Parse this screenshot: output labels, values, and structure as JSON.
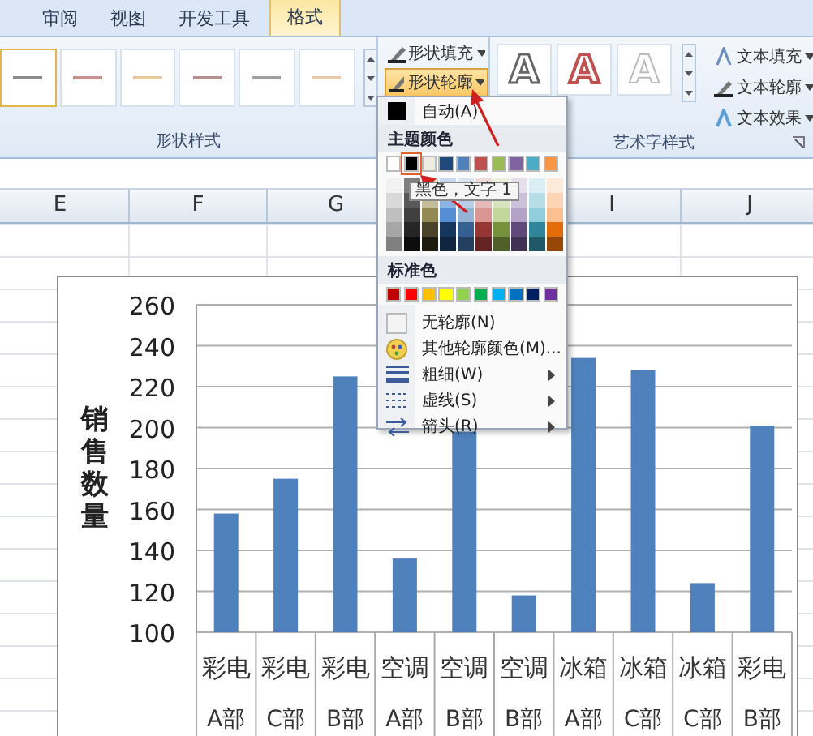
{
  "ribbon": {
    "tabs": [
      {
        "label": "审阅",
        "selected": false
      },
      {
        "label": "视图",
        "selected": false
      },
      {
        "label": "开发工具",
        "selected": false
      },
      {
        "label": "格式",
        "selected": true
      }
    ],
    "shape_styles": {
      "label": "形状样式",
      "presets": [
        {
          "color": "#8c8c8c",
          "selected": true
        },
        {
          "color": "#c89090",
          "selected": false
        },
        {
          "color": "#e8c89c",
          "selected": false
        },
        {
          "color": "#b89090",
          "selected": false
        },
        {
          "color": "#a0a0a0",
          "selected": false
        },
        {
          "color": "#e8c8a8",
          "selected": false
        }
      ]
    },
    "shape_commands": [
      {
        "label": "形状填充",
        "highlighted": false
      },
      {
        "label": "形状轮廓",
        "highlighted": true
      }
    ],
    "wordart_styles": {
      "label": "艺术字样式",
      "samples": [
        {
          "text": "A",
          "kind": "outline"
        },
        {
          "text": "A",
          "kind": "red"
        },
        {
          "text": "A",
          "kind": "light"
        }
      ]
    },
    "text_commands": [
      {
        "label": "文本填充",
        "kind": "fill"
      },
      {
        "label": "文本轮廓",
        "kind": "outline"
      },
      {
        "label": "文本效果",
        "kind": "effect"
      }
    ]
  },
  "sheet": {
    "columns": [
      "E",
      "F",
      "G",
      "I",
      "J"
    ]
  },
  "chart": {
    "chart_data": {
      "type": "bar",
      "ylabel": "销售数量",
      "categories": [
        "彩电",
        "彩电",
        "彩电",
        "空调",
        "空调",
        "空调",
        "冰箱",
        "冰箱",
        "冰箱",
        "彩电"
      ],
      "series": [
        {
          "color": "#4f81bd",
          "values": [
            158,
            175,
            225,
            136,
            198,
            118,
            234,
            228,
            124,
            201
          ]
        }
      ],
      "ylim": [
        100,
        260
      ],
      "yticks": [
        100,
        120,
        140,
        160,
        180,
        200,
        220,
        240,
        260
      ],
      "grid": true
    },
    "department_labels": [
      "A部",
      "C部",
      "B部",
      "A部",
      "B部",
      "B部",
      "A部",
      "C部",
      "C部",
      "B部"
    ]
  },
  "outline_menu": {
    "auto": {
      "label": "自动(A)"
    },
    "theme_heading": "主题颜色",
    "theme_colors": [
      {
        "color": "#ffffff",
        "selected": false,
        "shades": [
          {
            "color": "#f2f2f2"
          },
          {
            "color": "#d9d9d9"
          },
          {
            "color": "#bfbfbf"
          },
          {
            "color": "#a6a6a6"
          },
          {
            "color": "#808080"
          }
        ]
      },
      {
        "color": "#000000",
        "selected": true,
        "shades": [
          {
            "color": "#7f7f7f"
          },
          {
            "color": "#595959"
          },
          {
            "color": "#404040"
          },
          {
            "color": "#262626"
          },
          {
            "color": "#0d0d0d"
          }
        ]
      },
      {
        "color": "#eeece1",
        "selected": false,
        "shades": [
          {
            "color": "#ddd9c3"
          },
          {
            "color": "#c4bd97"
          },
          {
            "color": "#938953"
          },
          {
            "color": "#494429"
          },
          {
            "color": "#1d1b10"
          }
        ]
      },
      {
        "color": "#1f497d",
        "selected": false,
        "shades": [
          {
            "color": "#c6d9f0"
          },
          {
            "color": "#8db3e2"
          },
          {
            "color": "#548dd4"
          },
          {
            "color": "#17365d"
          },
          {
            "color": "#0f243e"
          }
        ]
      },
      {
        "color": "#4f81bd",
        "selected": false,
        "shades": [
          {
            "color": "#dbe5f1"
          },
          {
            "color": "#b8cce4"
          },
          {
            "color": "#95b3d7"
          },
          {
            "color": "#366092"
          },
          {
            "color": "#244061"
          }
        ]
      },
      {
        "color": "#c0504d",
        "selected": false,
        "shades": [
          {
            "color": "#f2dcdb"
          },
          {
            "color": "#e5b9b7"
          },
          {
            "color": "#d99694"
          },
          {
            "color": "#953734"
          },
          {
            "color": "#632423"
          }
        ]
      },
      {
        "color": "#9bbb59",
        "selected": false,
        "shades": [
          {
            "color": "#ebf1dd"
          },
          {
            "color": "#d7e3bc"
          },
          {
            "color": "#c3d69b"
          },
          {
            "color": "#76923c"
          },
          {
            "color": "#4f6128"
          }
        ]
      },
      {
        "color": "#8064a2",
        "selected": false,
        "shades": [
          {
            "color": "#e5e0ec"
          },
          {
            "color": "#ccc1d9"
          },
          {
            "color": "#b2a2c7"
          },
          {
            "color": "#5f497a"
          },
          {
            "color": "#3f3151"
          }
        ]
      },
      {
        "color": "#4bacc6",
        "selected": false,
        "shades": [
          {
            "color": "#dbeef3"
          },
          {
            "color": "#b7dde8"
          },
          {
            "color": "#92cddc"
          },
          {
            "color": "#31859b"
          },
          {
            "color": "#205867"
          }
        ]
      },
      {
        "color": "#f79646",
        "selected": false,
        "shades": [
          {
            "color": "#fdeada"
          },
          {
            "color": "#fbd5b5"
          },
          {
            "color": "#fac08f"
          },
          {
            "color": "#e36c09"
          },
          {
            "color": "#974806"
          }
        ]
      }
    ],
    "tooltip": "黑色，文字 1",
    "standard_heading": "标准色",
    "standard_colors": [
      {
        "color": "#c00000"
      },
      {
        "color": "#ff0000"
      },
      {
        "color": "#ffc000"
      },
      {
        "color": "#ffff00"
      },
      {
        "color": "#92d050"
      },
      {
        "color": "#00b050"
      },
      {
        "color": "#00b0f0"
      },
      {
        "color": "#0070c0"
      },
      {
        "color": "#002060"
      },
      {
        "color": "#7030a0"
      }
    ],
    "items": [
      {
        "label": "无轮廓(N)",
        "kind": "none",
        "submenu": false
      },
      {
        "label": "其他轮廓颜色(M)...",
        "kind": "more",
        "submenu": false
      },
      {
        "label": "粗细(W)",
        "kind": "weight",
        "submenu": true
      },
      {
        "label": "虚线(S)",
        "kind": "dash",
        "submenu": true
      },
      {
        "label": "箭头(R)",
        "kind": "arrows",
        "submenu": true
      }
    ]
  }
}
